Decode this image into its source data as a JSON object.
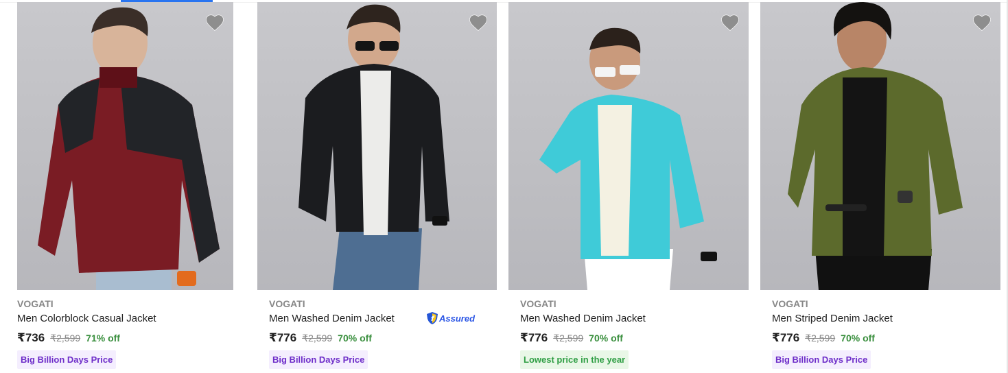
{
  "colors": {
    "accent": "#2874f0",
    "discount": "#388e3c",
    "tag_purple": "#6e2ec9",
    "tag_green": "#2f9e44"
  },
  "products": [
    {
      "brand": "VOGATI",
      "title": "Men Colorblock Casual Jacket",
      "price": "₹736",
      "mrp": "₹2,599",
      "discount": "71% off",
      "tag": "Big Billion Days Price",
      "tag_style": "purple",
      "assured": null,
      "jacket_color": "maroon-black"
    },
    {
      "brand": "VOGATI",
      "title": "Men Washed Denim Jacket",
      "price": "₹776",
      "mrp": "₹2,599",
      "discount": "70% off",
      "tag": "Big Billion Days Price",
      "tag_style": "purple",
      "assured": "Assured",
      "jacket_color": "black"
    },
    {
      "brand": "VOGATI",
      "title": "Men Washed Denim Jacket",
      "price": "₹776",
      "mrp": "₹2,599",
      "discount": "70% off",
      "tag": "Lowest price in the year",
      "tag_style": "green",
      "assured": null,
      "jacket_color": "turquoise"
    },
    {
      "brand": "VOGATI",
      "title": "Men Striped Denim Jacket",
      "price": "₹776",
      "mrp": "₹2,599",
      "discount": "70% off",
      "tag": "Big Billion Days Price",
      "tag_style": "purple",
      "assured": null,
      "jacket_color": "olive"
    }
  ]
}
